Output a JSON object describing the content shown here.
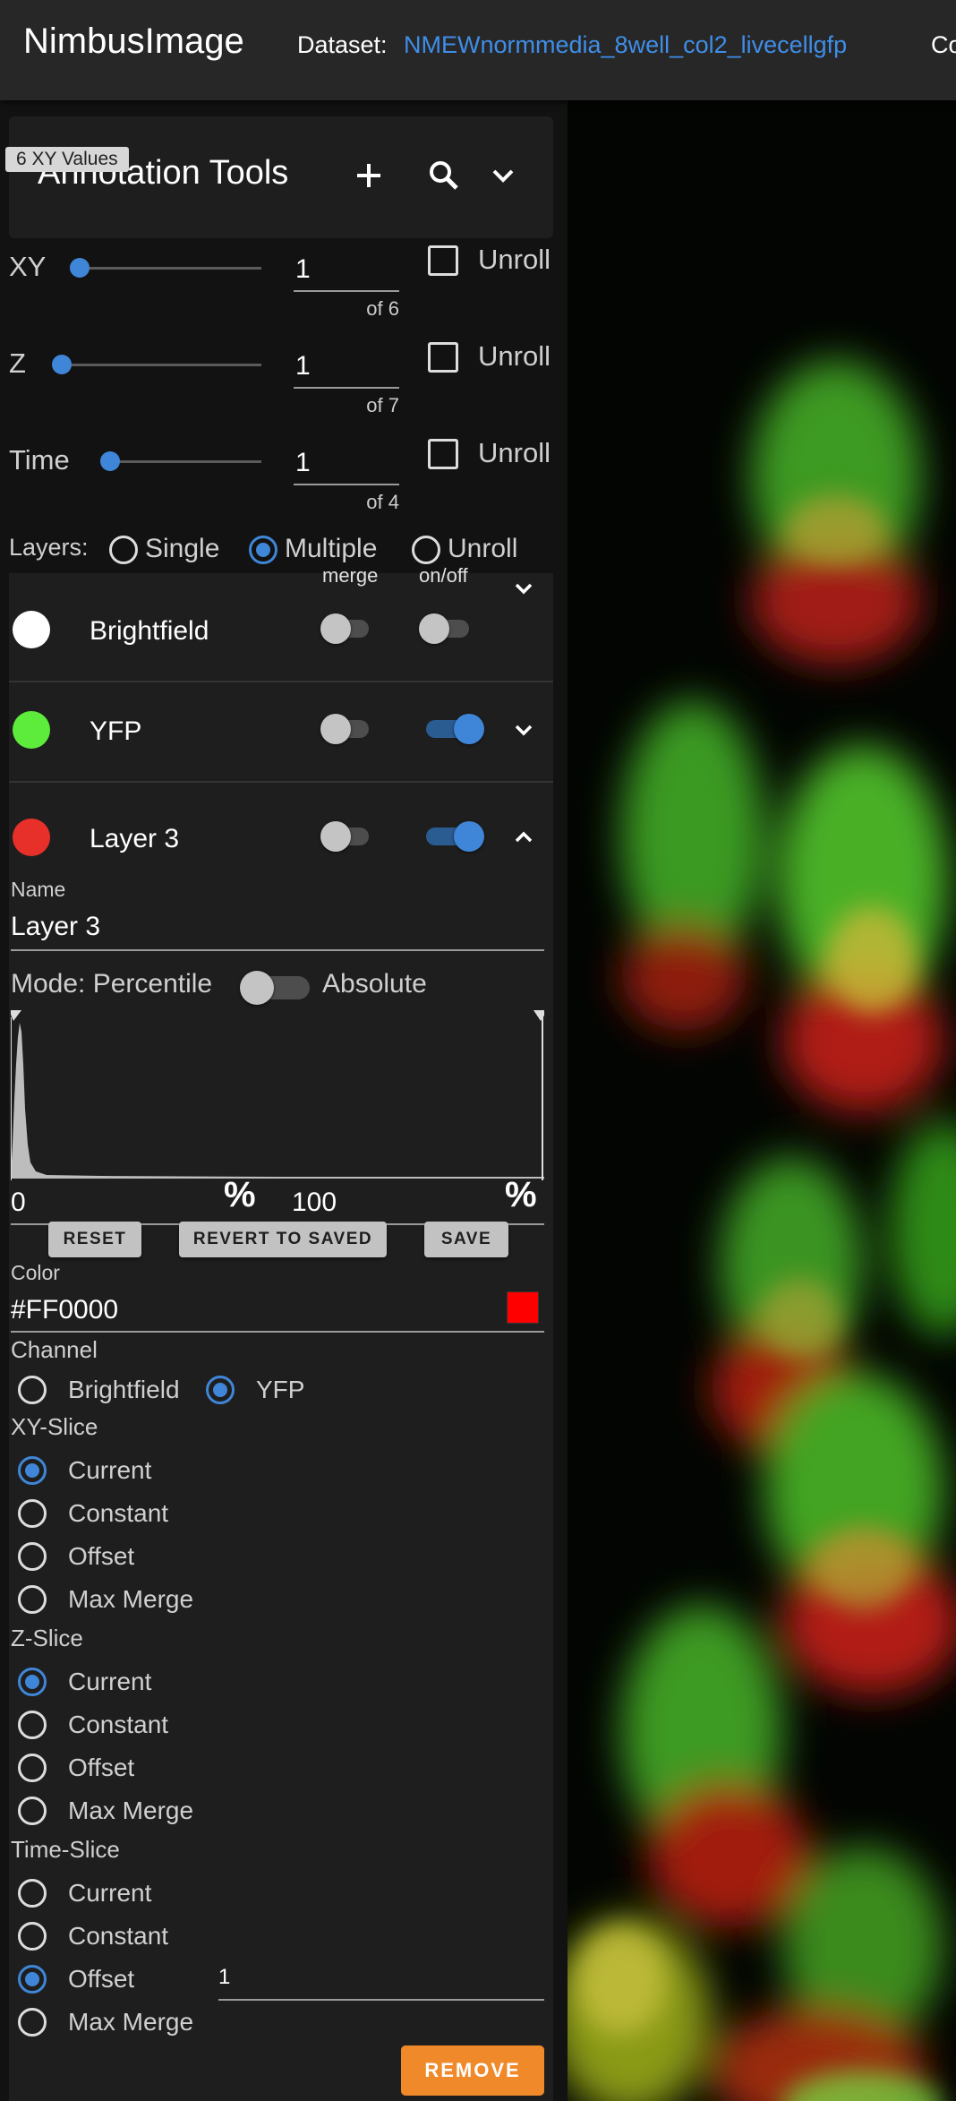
{
  "topbar": {
    "app_title": "NimbusImage",
    "dataset_label": "Dataset:",
    "dataset_name": "NMEWnormmedia_8well_col2_livecellgfp",
    "cut_text": "Co"
  },
  "tools": {
    "title": "Annotation Tools",
    "tooltip": "6 XY Values",
    "add_icon": "plus-icon",
    "search_icon": "search-icon",
    "expand_icon": "chevron-down-icon"
  },
  "sliders": [
    {
      "label": "XY",
      "value": "1",
      "of": "of 6",
      "unroll": "Unroll"
    },
    {
      "label": "Z",
      "value": "1",
      "of": "of 7",
      "unroll": "Unroll"
    },
    {
      "label": "Time",
      "value": "1",
      "of": "of 4",
      "unroll": "Unroll"
    }
  ],
  "layers_mode": {
    "label": "Layers:",
    "options": [
      "Single",
      "Multiple",
      "Unroll"
    ],
    "selected": "Multiple"
  },
  "layer_columns": {
    "merge": "merge",
    "onoff": "on/off"
  },
  "layers": [
    {
      "name": "Brightfield",
      "color": "#FFFFFF",
      "merge": false,
      "visible": false,
      "expanded": false
    },
    {
      "name": "YFP",
      "color": "#5DEB3C",
      "merge": false,
      "visible": true,
      "expanded": false
    },
    {
      "name": "Layer 3",
      "color": "#E8302A",
      "merge": false,
      "visible": true,
      "expanded": true
    }
  ],
  "editor": {
    "name_label": "Name",
    "name_value": "Layer 3",
    "mode_label": "Mode: Percentile",
    "mode_alt": "Absolute",
    "min_value": "0",
    "max_value": "100",
    "reset": "RESET",
    "revert": "REVERT TO SAVED",
    "save": "SAVE",
    "color_label": "Color",
    "color_value": "#FF0000",
    "channel_label": "Channel",
    "channels": [
      "Brightfield",
      "YFP"
    ],
    "channel_selected": "YFP",
    "xy_label": "XY-Slice",
    "z_label": "Z-Slice",
    "t_label": "Time-Slice",
    "slice_options": [
      "Current",
      "Constant",
      "Offset",
      "Max Merge"
    ],
    "xy_selected": "Current",
    "z_selected": "Current",
    "t_selected": "Offset",
    "t_offset_value": "1",
    "remove": "REMOVE"
  },
  "colors": {
    "accent": "#3F86D8",
    "remove": "#F0892A",
    "link": "#3F8EE8"
  }
}
